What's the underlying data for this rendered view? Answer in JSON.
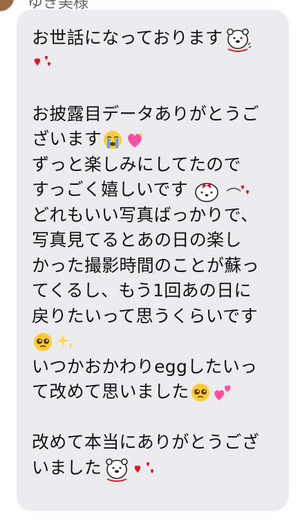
{
  "header": {
    "sender_name_partial": "ゆき美様"
  },
  "message": {
    "lines": [
      "お世話になっております",
      "",
      "",
      "お披露目データありがとうご",
      "ざいます",
      "ずっと楽しみにしてたので",
      "すっごく嬉しいです",
      "どれもいい写真ばっかりで、",
      "写真見てるとあの日の楽し",
      "かった撮影時間のことが蘇っ",
      "てくるし、もう1回あの日に",
      "戻りたいって思うくらいです",
      "",
      "いつかおかわりeggしたいっ",
      "て改めて思いました",
      "",
      "改めて本当にありがとうござ",
      "いました"
    ]
  },
  "icons": {
    "bear_sticker": "bear-sticker-icon",
    "red_hearts": "red-hearts-icon",
    "crying_face": "loudly-crying-face-icon",
    "sparkling_heart": "sparkling-heart-icon",
    "pleading_face": "pleading-face-icon",
    "sparkles": "sparkles-icon",
    "two_hearts": "two-hearts-icon",
    "bear_with_bow": "bear-with-bow-sticker-icon"
  },
  "colors": {
    "bubble_bg": "#ececee",
    "text": "#111111",
    "heart_red": "#e0162b",
    "heart_pink": "#ff4fa3"
  }
}
